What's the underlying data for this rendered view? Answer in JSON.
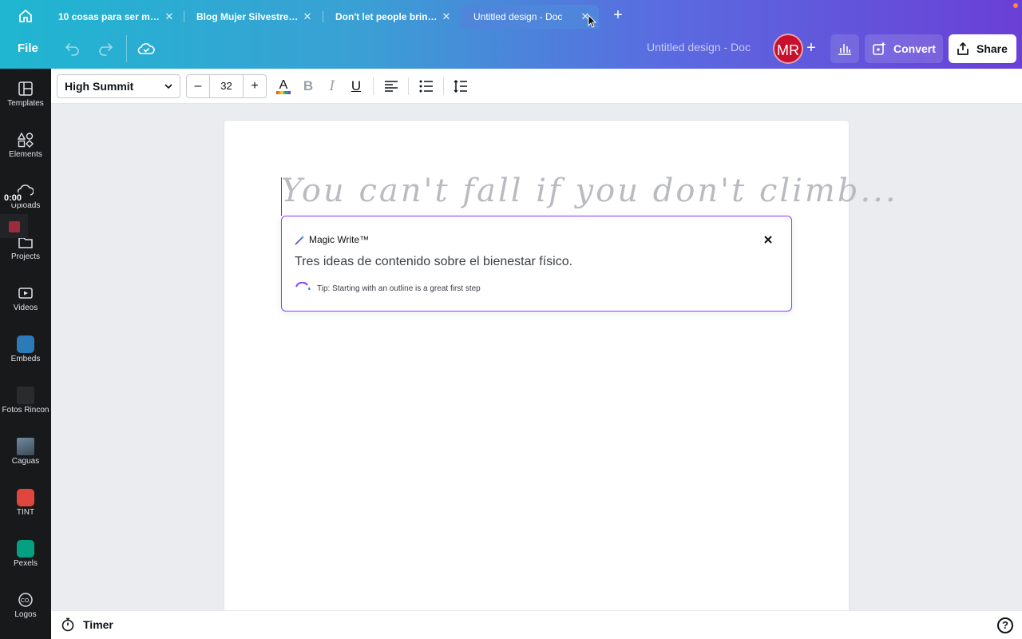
{
  "browser": {
    "tabs": [
      {
        "label": "10 cosas para ser mas ...",
        "close": "✕"
      },
      {
        "label": "Blog Mujer Silvestre - ...",
        "close": "✕"
      },
      {
        "label": "Don't let people bring ...",
        "close": "✕"
      },
      {
        "label": "Untitled design - Doc",
        "close": "✕",
        "active": true
      }
    ],
    "new_tab": "+"
  },
  "header": {
    "file_label": "File",
    "doc_title": "Untitled design - Doc",
    "avatar_initials": "MR",
    "avatar_add": "+",
    "convert_label": "Convert",
    "share_label": "Share"
  },
  "sidebar": {
    "items": [
      {
        "label": "Templates",
        "icon": "templates-icon"
      },
      {
        "label": "Elements",
        "icon": "elements-icon"
      },
      {
        "label": "Uploads",
        "icon": "uploads-icon"
      },
      {
        "label": "Projects",
        "icon": "projects-icon"
      },
      {
        "label": "Videos",
        "icon": "videos-icon"
      },
      {
        "label": "Embeds",
        "icon": "embeds-icon"
      },
      {
        "label": "Fotos Rincon",
        "icon": "photo-thumb"
      },
      {
        "label": "Caguas",
        "icon": "photo-thumb"
      },
      {
        "label": "TINT",
        "icon": "tint-app-icon"
      },
      {
        "label": "Pexels",
        "icon": "pexels-app-icon"
      },
      {
        "label": "Logos",
        "icon": "logos-icon"
      }
    ],
    "recording_time": "0:00"
  },
  "format_toolbar": {
    "font_name": "High Summit",
    "font_size": "32",
    "decrease": "–",
    "increase": "+",
    "text_color_glyph": "A",
    "bold_glyph": "B",
    "italic_glyph": "I",
    "underline_glyph": "U"
  },
  "canvas": {
    "script_text": "You can't fall if you don't climb..."
  },
  "magic_write": {
    "title": "Magic Write™",
    "prompt": "Tres ideas de contenido sobre el bienestar físico.",
    "tip": "Tip: Starting with an outline is a great first step"
  },
  "bottom": {
    "timer_label": "Timer",
    "help": "?"
  },
  "colors": {
    "accent_purple": "#8b3dff",
    "avatar_red": "#c8102e",
    "sidebar_bg": "#18191b"
  }
}
